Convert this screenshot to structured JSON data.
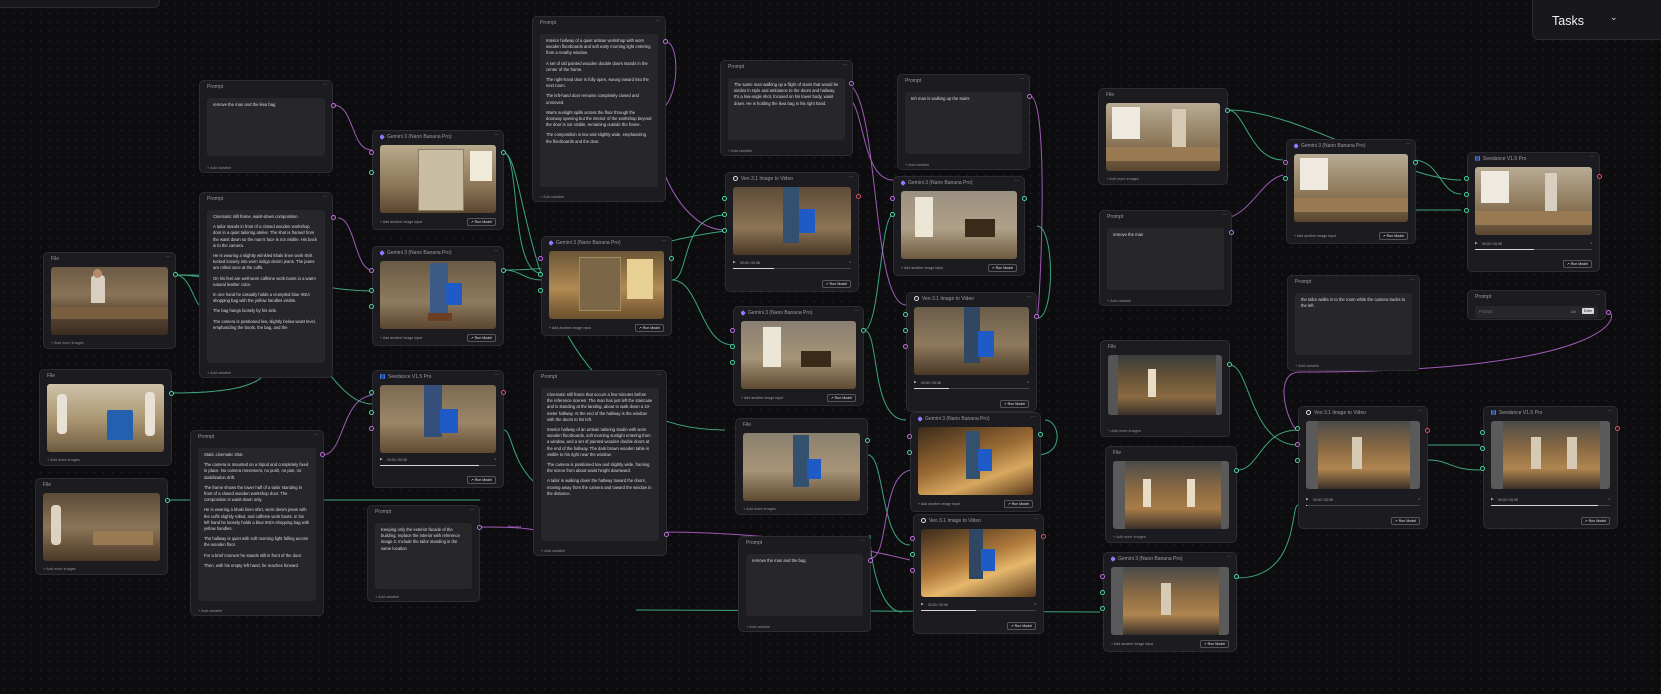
{
  "tasks_button": {
    "label": "Tasks",
    "icon": "chevron-down-icon"
  },
  "labels": {
    "prompt": "Prompt",
    "file": "File",
    "add_variable": "+ Add variable",
    "add_more_images": "+ Add more images",
    "add_another_image_input": "+ Add another image input",
    "run_model": "↗ Run Model",
    "timecode": "00:00 / 00:08",
    "connection_prompt": "Prompt",
    "seedance_prompt_placeholder": "Prompt",
    "seedance_prompt_tag_1": "Ctrl",
    "seedance_prompt_tag_2": "Enter"
  },
  "models": {
    "gemini3": "Gemini 3 (Nano Banana Pro)",
    "veo31": "Veo 3.1 Image to Video",
    "seedance": "Seedance V1.5 Pro"
  },
  "prompts": {
    "p1": [
      "remove the man and the ikea bag"
    ],
    "p2": [
      "Cinematic still frame, waist-down composition.",
      "A tailor stands in front of a closed wooden workshop door in a quiet tailoring atelier. The shot is framed from the waist down so the man's face is not visible. His back is to the camera.",
      "He is wearing a slightly wrinkled khaki linen work shirt tucked loosely into worn indigo denim jeans. The jeans are rolled once at the cuffs.",
      "On his feet are well-worn caffeine work boots in a warm natural leather color.",
      "In one hand he casually holds a crumpled blue IKEA shopping bag with the yellow handles visible.",
      "The bag hangs loosely by his side.",
      "The camera is positioned low, slightly below waist level, emphasizing the boots, the bag, and the"
    ],
    "p3": [
      "Static cinematic shot.",
      "The camera is mounted on a tripod and completely fixed in place. No camera movement, no push, no pan, no stabilization drift.",
      "The frame shows the lower half of a tailor standing in front of a closed wooden workshop door. The composition is waist-down only.",
      "He is wearing a khaki linen shirt, worn denim jeans with the cuffs slightly rolled, and caffeine work boots. In his left hand he loosely holds a blue IKEA shopping bag with yellow handles.",
      "The hallway is quiet with soft morning light falling across the wooden floor.",
      "For a brief moment he stands still in front of the door.",
      "Then, with his empty left hand, he reaches forward"
    ],
    "p4": [
      "Keeping only the exterior facade of the building, replace the interior with reference image 2. Include the tailor standing in the same location"
    ],
    "p5": [
      "Interior hallway of a quiet artisan workshop with worn wooden floorboards and soft early morning light entering from a nearby window.",
      "A set of old painted wooden double doors stands in the center of the frame.",
      "The right-hand door is fully open, swung inward into the next room.",
      "The left-hand door remains completely closed and unmoved.",
      "Warm sunlight spills across the floor through the doorway opening but the interior of the workshop beyond the door is not visible, remaining outside the frame.",
      "The composition is low and slightly wide, emphasizing the floorboards and the door."
    ],
    "p6": [
      "Cinematic still frame that occurs a few minutes before the reference scenes. The man has just left the staircase and is standing at the landing, about to walk down a 10-meter hallway. At the end of the hallway is the window with the doors to his left.",
      "Interior hallway of an artisan tailoring studio with worn wooden floorboards, soft morning sunlight entering from a window, and a set of painted wooden double doors at the end of the hallway. The dark brown wooden table is visible to his right near the window.",
      "The camera is positioned low and slightly wide, framing the scene from about waist height downward.",
      "A tailor is walking down the hallway toward the doors, moving away from the camera and toward the window in the distance."
    ],
    "p7": [
      "The same man walking up a flight of stairs that would be similar in style and ambiance to the doors and hallway. It's a low-angle shot, focused on his lower body, waist down. He is holding the ikea bag in his right hand."
    ],
    "p8": [
      "teh man is walking up the stairs"
    ],
    "p9": [
      "remove the man and the bag"
    ],
    "p10": [
      "remove the man"
    ],
    "p11": [
      "the tailor walks in to the room while the camera tracks to the left."
    ]
  }
}
